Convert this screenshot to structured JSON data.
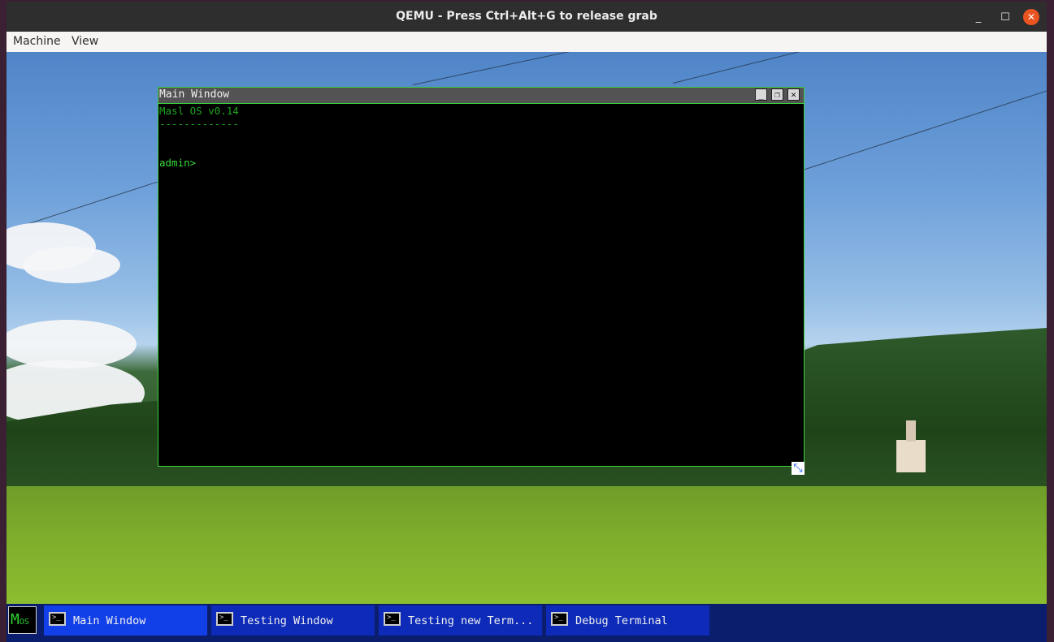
{
  "window": {
    "title": "QEMU - Press Ctrl+Alt+G to release grab",
    "controls": {
      "minimize": "_",
      "maximize": "☐",
      "close": "✕"
    }
  },
  "menu": {
    "items": [
      "Machine",
      "View"
    ]
  },
  "guest_window": {
    "title": "Main Window",
    "buttons": [
      "_",
      "❐",
      "✕"
    ],
    "lines": [
      "Masl OS v0.14",
      "-------------",
      "",
      "admin>"
    ]
  },
  "taskbar": {
    "logo": {
      "main": "M",
      "sub": "OS"
    },
    "items": [
      {
        "label": "Main Window",
        "active": true
      },
      {
        "label": "Testing Window",
        "active": false
      },
      {
        "label": "Testing new Term...",
        "active": false
      },
      {
        "label": "Debug Terminal",
        "active": false
      }
    ]
  },
  "colors": {
    "terminal_text": "#1fa61f",
    "window_border": "#3bd13b",
    "taskbar": "#0b1e6e",
    "task_active": "#1240e8",
    "close_button": "#e95420"
  }
}
